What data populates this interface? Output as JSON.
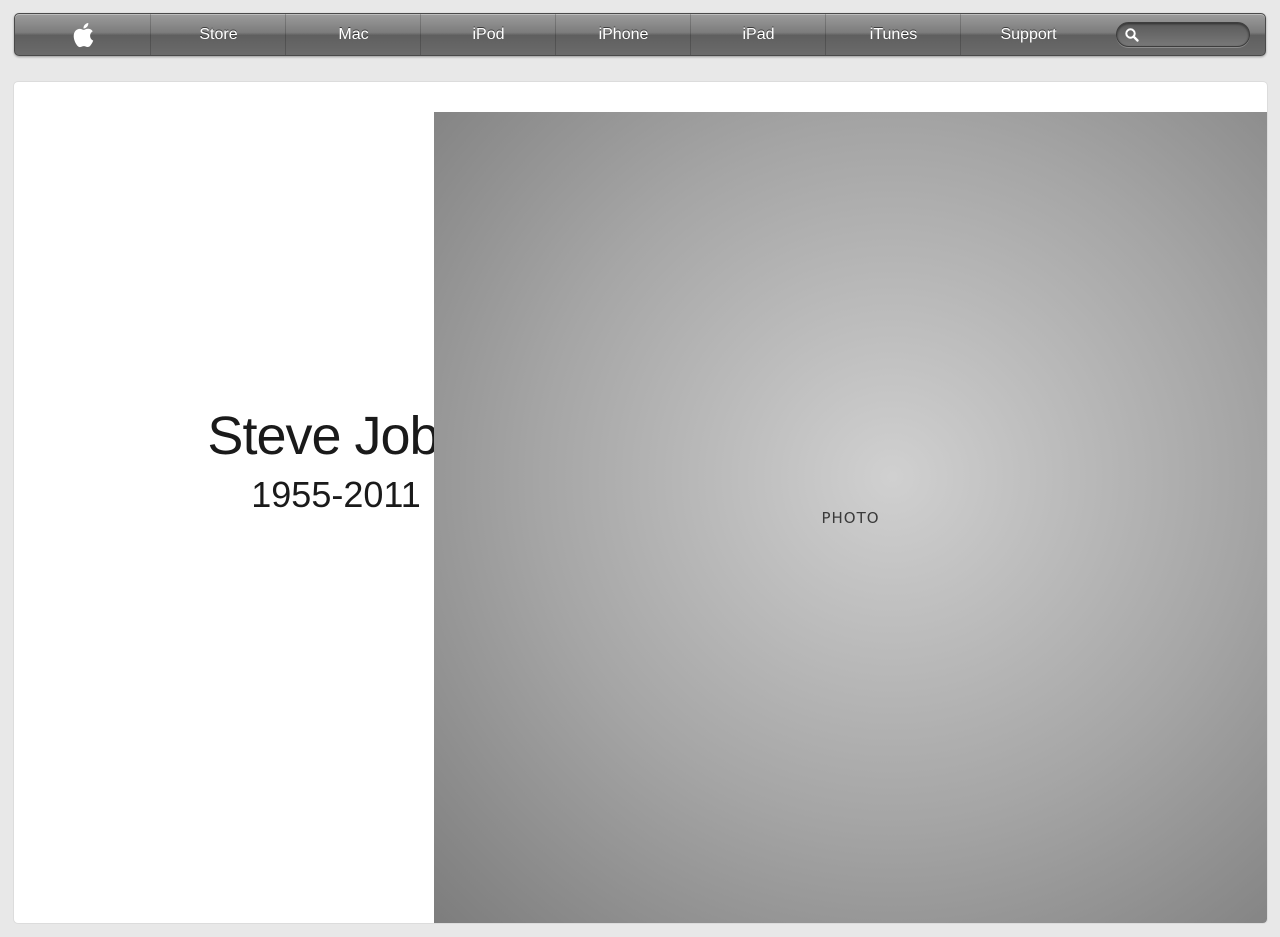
{
  "nav": {
    "items": [
      {
        "label": "Store"
      },
      {
        "label": "Mac"
      },
      {
        "label": "iPod"
      },
      {
        "label": "iPhone"
      },
      {
        "label": "iPad"
      },
      {
        "label": "iTunes"
      },
      {
        "label": "Support"
      }
    ],
    "search": {
      "value": ""
    }
  },
  "hero": {
    "name": "Steve Jobs",
    "dates": "1955-2011"
  },
  "colors": {
    "nav_gradient_top": "#9c9c9c",
    "nav_gradient_bottom": "#5f5f5f",
    "page_background": "#e8e8e8",
    "hero_background": "#ffffff",
    "headline_text": "#1a1a1a"
  },
  "icons": {
    "logo": "apple-logo-icon",
    "search": "magnifier-icon"
  }
}
